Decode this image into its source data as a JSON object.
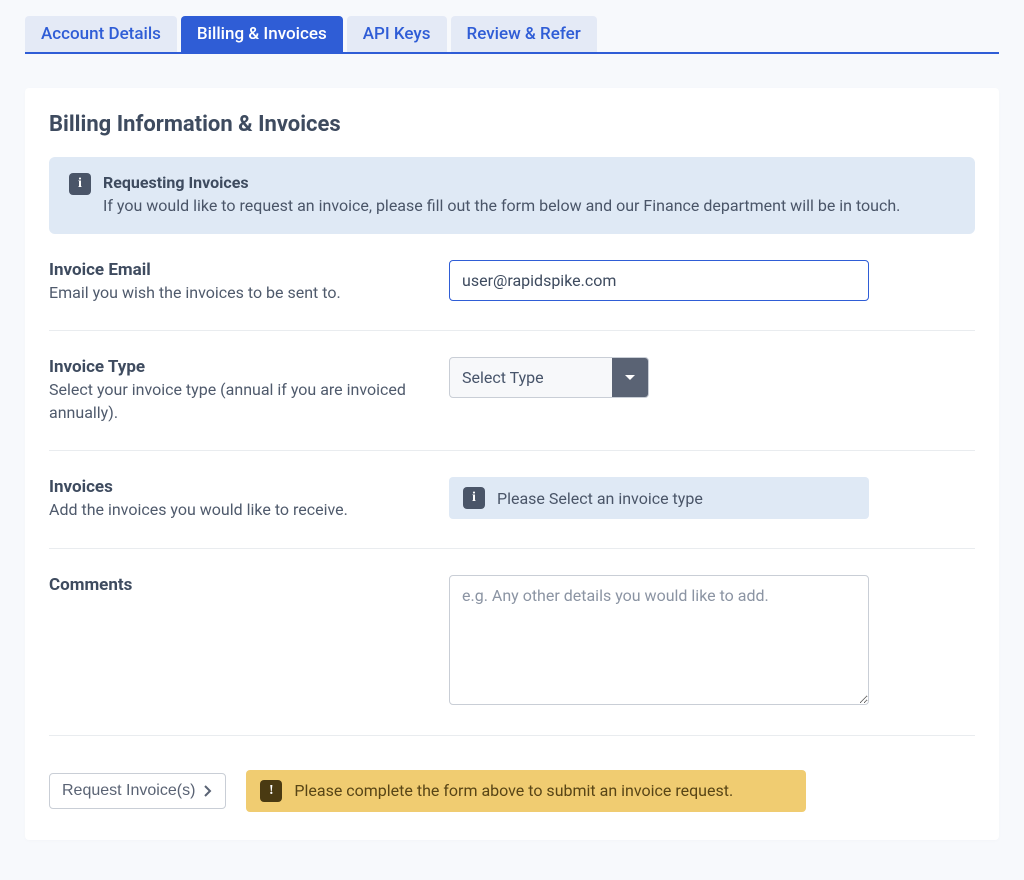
{
  "tabs": [
    {
      "label": "Account Details",
      "active": false
    },
    {
      "label": "Billing & Invoices",
      "active": true
    },
    {
      "label": "API Keys",
      "active": false
    },
    {
      "label": "Review & Refer",
      "active": false
    }
  ],
  "page": {
    "title": "Billing Information & Invoices"
  },
  "request_alert": {
    "title": "Requesting Invoices",
    "text": "If you would like to request an invoice, please fill out the form below and our Finance department will be in touch."
  },
  "fields": {
    "email": {
      "label": "Invoice Email",
      "help": "Email you wish the invoices to be sent to.",
      "value": "user@rapidspike.com"
    },
    "type": {
      "label": "Invoice Type",
      "help": "Select your invoice type (annual if you are invoiced annually).",
      "selected": "Select Type"
    },
    "invoices": {
      "label": "Invoices",
      "help": "Add the invoices you would like to receive.",
      "info": "Please Select an invoice type"
    },
    "comments": {
      "label": "Comments",
      "placeholder": "e.g. Any other details you would like to add."
    }
  },
  "submit": {
    "button": "Request Invoice(s)",
    "warning": "Please complete the form above to submit an invoice request."
  },
  "colors": {
    "primary": "#2f5dd6",
    "text": "#3e4b5f",
    "info_bg": "#dfe9f5",
    "warning_bg": "#f0cc71"
  }
}
